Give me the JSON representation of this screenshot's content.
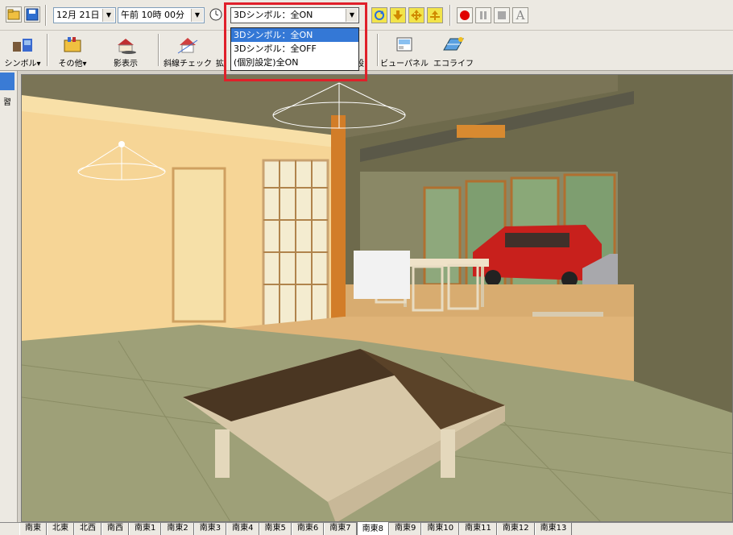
{
  "toolbar": {
    "date_value": "12月 21日",
    "time_value": "午前 10時 00分",
    "symbol_select": {
      "selected": "3Dシンボル：全ON",
      "options": [
        "3Dシンボル：全ON",
        "3Dシンボル：全OFF",
        "(個別設定)全ON"
      ]
    },
    "text_button": "A",
    "record_color": "#e00000"
  },
  "toolbar2": {
    "symbol_label": "シンボル▾",
    "other_label": "その他▾",
    "shadow_label": "影表示",
    "slope_label": "斜線チェック",
    "partial_label": "拡",
    "hidden_label": "設",
    "viewpanel_label": "ビューパネル",
    "ecolife_label": "エコライフ"
  },
  "leftpanel": {
    "text": "習"
  },
  "tabs": [
    "南東",
    "北東",
    "北西",
    "南西",
    "南東1",
    "南東2",
    "南東3",
    "南東4",
    "南東5",
    "南東6",
    "南東7",
    "南東8",
    "南東9",
    "南東10",
    "南東11",
    "南東12",
    "南東13"
  ],
  "active_tab": "南東8",
  "colors": {
    "highlight": "#e0202a",
    "selection": "#3478d6"
  }
}
